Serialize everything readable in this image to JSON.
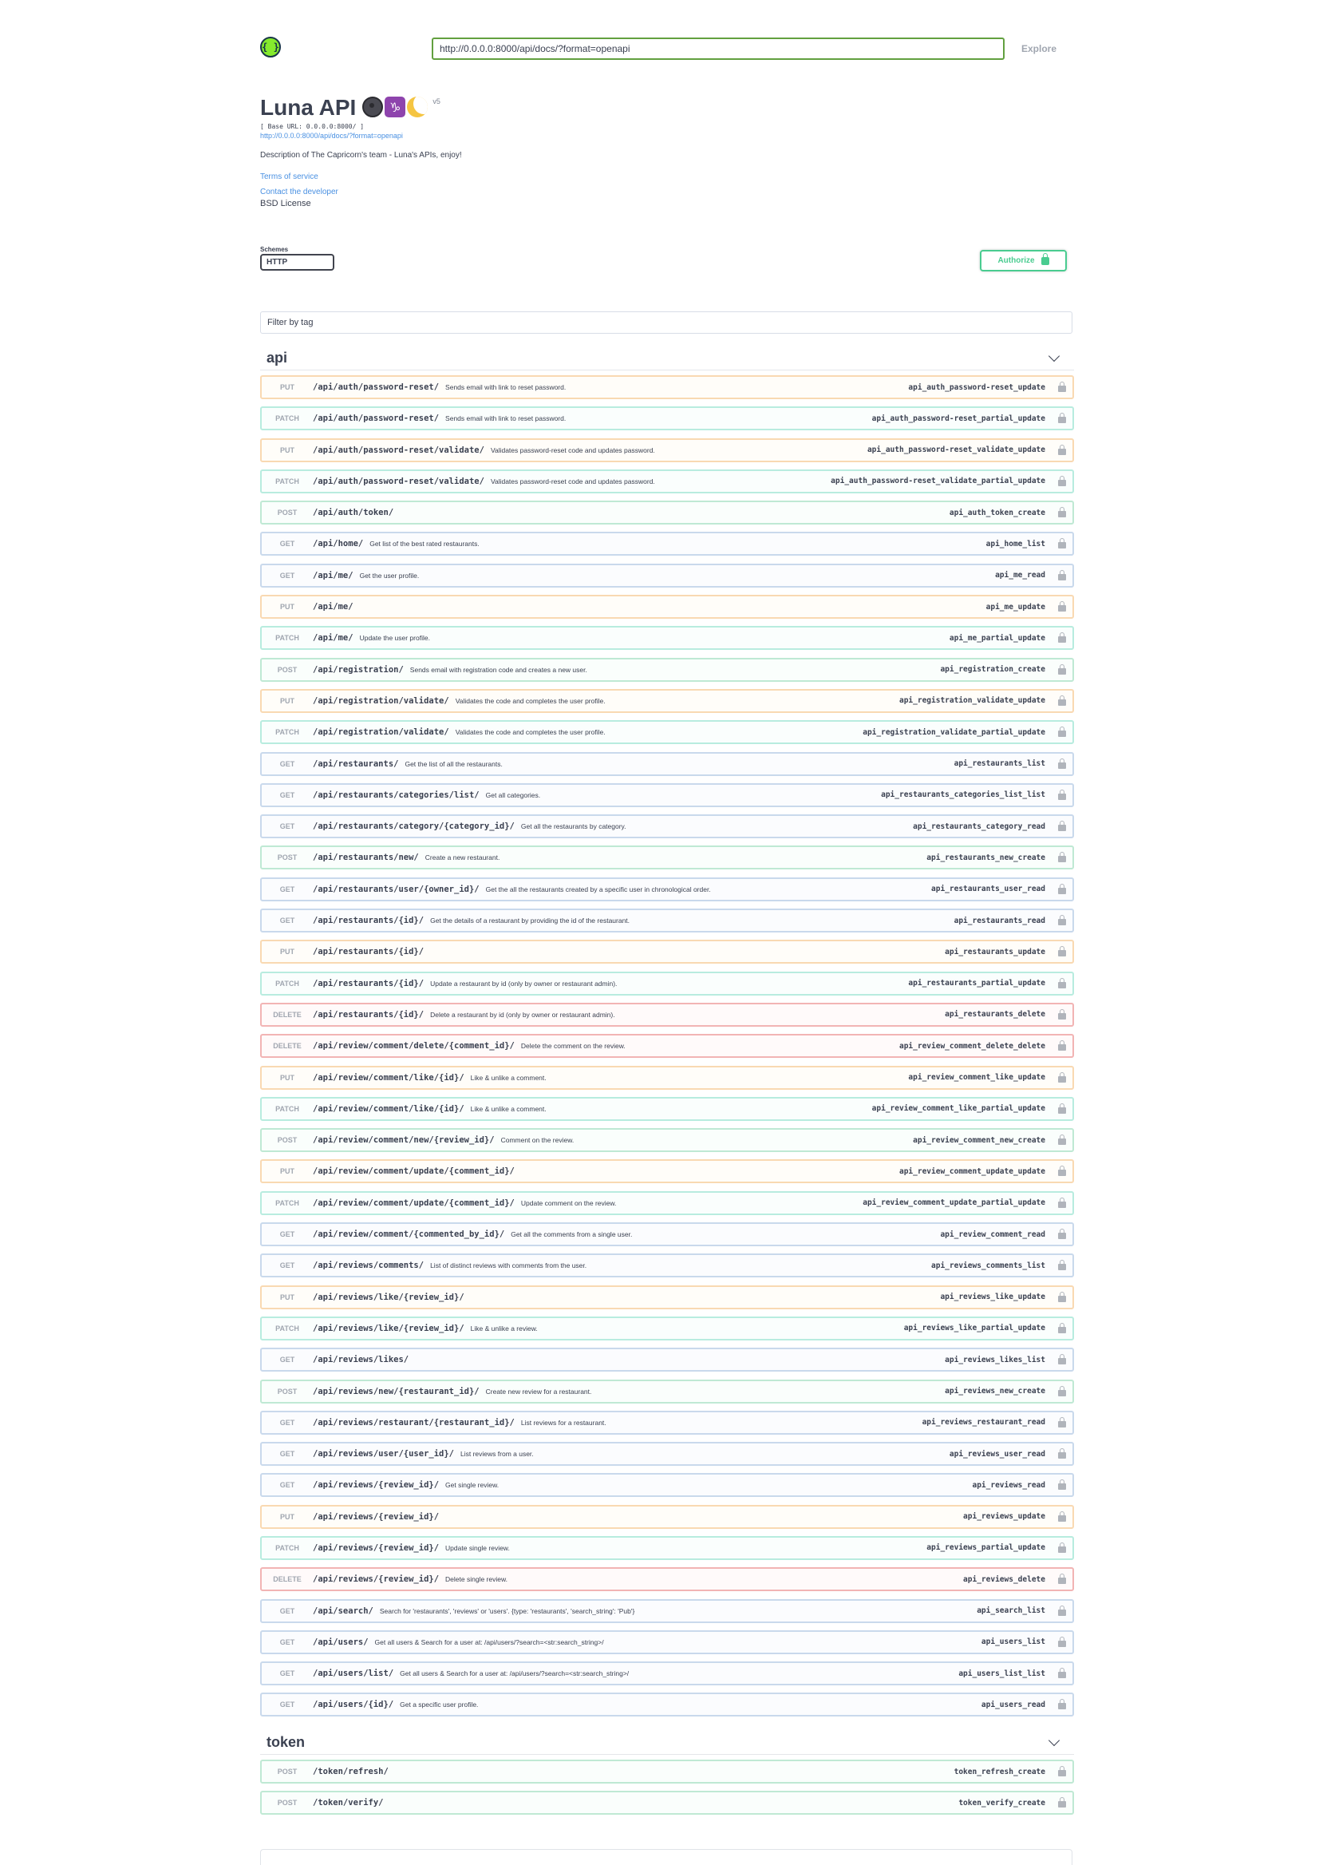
{
  "topbar": {
    "logo_glyph": "{ }",
    "url_value": "http://0.0.0.0:8000/api/docs/?format=openapi",
    "explore_label": "Explore"
  },
  "info": {
    "title": "Luna API",
    "emoji_cap": "♑",
    "version": "v5",
    "base_url": "[ Base URL: 0.0.0.0:8000/ ]",
    "spec_url": "http://0.0.0.0:8000/api/docs/?format=openapi",
    "description": "Description of The Capricorn's team - Luna's APIs, enjoy!",
    "terms_label": "Terms of service",
    "contact_label": "Contact the developer",
    "license_label": "BSD License"
  },
  "schemes": {
    "label": "Schemes",
    "selected": "HTTP",
    "authorize_label": "Authorize"
  },
  "filter": {
    "placeholder": "Filter by tag"
  },
  "tags": [
    {
      "name": "api",
      "operations": [
        {
          "method": "PUT",
          "path": "/api/auth/password-reset/",
          "summary": "Sends email with link to reset password.",
          "operation_id": "api_auth_password-reset_update"
        },
        {
          "method": "PATCH",
          "path": "/api/auth/password-reset/",
          "summary": "Sends email with link to reset password.",
          "operation_id": "api_auth_password-reset_partial_update"
        },
        {
          "method": "PUT",
          "path": "/api/auth/password-reset/validate/",
          "summary": "Validates password-reset code and updates password.",
          "operation_id": "api_auth_password-reset_validate_update"
        },
        {
          "method": "PATCH",
          "path": "/api/auth/password-reset/validate/",
          "summary": "Validates password-reset code and updates password.",
          "operation_id": "api_auth_password-reset_validate_partial_update"
        },
        {
          "method": "POST",
          "path": "/api/auth/token/",
          "summary": "",
          "operation_id": "api_auth_token_create"
        },
        {
          "method": "GET",
          "path": "/api/home/",
          "summary": "Get list of the best rated restaurants.",
          "operation_id": "api_home_list"
        },
        {
          "method": "GET",
          "path": "/api/me/",
          "summary": "Get the user profile.",
          "operation_id": "api_me_read"
        },
        {
          "method": "PUT",
          "path": "/api/me/",
          "summary": "",
          "operation_id": "api_me_update"
        },
        {
          "method": "PATCH",
          "path": "/api/me/",
          "summary": "Update the user profile.",
          "operation_id": "api_me_partial_update"
        },
        {
          "method": "POST",
          "path": "/api/registration/",
          "summary": "Sends email with registration code and creates a new user.",
          "operation_id": "api_registration_create"
        },
        {
          "method": "PUT",
          "path": "/api/registration/validate/",
          "summary": "Validates the code and completes the user profile.",
          "operation_id": "api_registration_validate_update"
        },
        {
          "method": "PATCH",
          "path": "/api/registration/validate/",
          "summary": "Validates the code and completes the user profile.",
          "operation_id": "api_registration_validate_partial_update"
        },
        {
          "method": "GET",
          "path": "/api/restaurants/",
          "summary": "Get the list of all the restaurants.",
          "operation_id": "api_restaurants_list"
        },
        {
          "method": "GET",
          "path": "/api/restaurants/categories/list/",
          "summary": "Get all categories.",
          "operation_id": "api_restaurants_categories_list_list"
        },
        {
          "method": "GET",
          "path": "/api/restaurants/category/{category_id}/",
          "summary": "Get all the restaurants by category.",
          "operation_id": "api_restaurants_category_read"
        },
        {
          "method": "POST",
          "path": "/api/restaurants/new/",
          "summary": "Create a new restaurant.",
          "operation_id": "api_restaurants_new_create"
        },
        {
          "method": "GET",
          "path": "/api/restaurants/user/{owner_id}/",
          "summary": "Get the all the restaurants created by a specific user in chronological order.",
          "operation_id": "api_restaurants_user_read"
        },
        {
          "method": "GET",
          "path": "/api/restaurants/{id}/",
          "summary": "Get the details of a restaurant by providing the id of the restaurant.",
          "operation_id": "api_restaurants_read"
        },
        {
          "method": "PUT",
          "path": "/api/restaurants/{id}/",
          "summary": "",
          "operation_id": "api_restaurants_update"
        },
        {
          "method": "PATCH",
          "path": "/api/restaurants/{id}/",
          "summary": "Update a restaurant by id (only by owner or restaurant admin).",
          "operation_id": "api_restaurants_partial_update"
        },
        {
          "method": "DELETE",
          "path": "/api/restaurants/{id}/",
          "summary": "Delete a restaurant by id (only by owner or restaurant admin).",
          "operation_id": "api_restaurants_delete"
        },
        {
          "method": "DELETE",
          "path": "/api/review/comment/delete/{comment_id}/",
          "summary": "Delete the comment on the review.",
          "operation_id": "api_review_comment_delete_delete"
        },
        {
          "method": "PUT",
          "path": "/api/review/comment/like/{id}/",
          "summary": "Like & unlike a comment.",
          "operation_id": "api_review_comment_like_update"
        },
        {
          "method": "PATCH",
          "path": "/api/review/comment/like/{id}/",
          "summary": "Like & unlike a comment.",
          "operation_id": "api_review_comment_like_partial_update"
        },
        {
          "method": "POST",
          "path": "/api/review/comment/new/{review_id}/",
          "summary": "Comment on the review.",
          "operation_id": "api_review_comment_new_create"
        },
        {
          "method": "PUT",
          "path": "/api/review/comment/update/{comment_id}/",
          "summary": "",
          "operation_id": "api_review_comment_update_update"
        },
        {
          "method": "PATCH",
          "path": "/api/review/comment/update/{comment_id}/",
          "summary": "Update comment on the review.",
          "operation_id": "api_review_comment_update_partial_update"
        },
        {
          "method": "GET",
          "path": "/api/review/comment/{commented_by_id}/",
          "summary": "Get all the comments from a single user.",
          "operation_id": "api_review_comment_read"
        },
        {
          "method": "GET",
          "path": "/api/reviews/comments/",
          "summary": "List of distinct reviews with comments from the user.",
          "operation_id": "api_reviews_comments_list"
        },
        {
          "method": "PUT",
          "path": "/api/reviews/like/{review_id}/",
          "summary": "",
          "operation_id": "api_reviews_like_update"
        },
        {
          "method": "PATCH",
          "path": "/api/reviews/like/{review_id}/",
          "summary": "Like & unlike a review.",
          "operation_id": "api_reviews_like_partial_update"
        },
        {
          "method": "GET",
          "path": "/api/reviews/likes/",
          "summary": "",
          "operation_id": "api_reviews_likes_list"
        },
        {
          "method": "POST",
          "path": "/api/reviews/new/{restaurant_id}/",
          "summary": "Create new review for a restaurant.",
          "operation_id": "api_reviews_new_create"
        },
        {
          "method": "GET",
          "path": "/api/reviews/restaurant/{restaurant_id}/",
          "summary": "List reviews for a restaurant.",
          "operation_id": "api_reviews_restaurant_read"
        },
        {
          "method": "GET",
          "path": "/api/reviews/user/{user_id}/",
          "summary": "List reviews from a user.",
          "operation_id": "api_reviews_user_read"
        },
        {
          "method": "GET",
          "path": "/api/reviews/{review_id}/",
          "summary": "Get single review.",
          "operation_id": "api_reviews_read"
        },
        {
          "method": "PUT",
          "path": "/api/reviews/{review_id}/",
          "summary": "",
          "operation_id": "api_reviews_update"
        },
        {
          "method": "PATCH",
          "path": "/api/reviews/{review_id}/",
          "summary": "Update single review.",
          "operation_id": "api_reviews_partial_update"
        },
        {
          "method": "DELETE",
          "path": "/api/reviews/{review_id}/",
          "summary": "Delete single review.",
          "operation_id": "api_reviews_delete"
        },
        {
          "method": "GET",
          "path": "/api/search/",
          "summary": "Search for 'restaurants', 'reviews' or 'users'. {type: 'restaurants', 'search_string': 'Pub'}",
          "operation_id": "api_search_list"
        },
        {
          "method": "GET",
          "path": "/api/users/",
          "summary": "Get all users & Search for a user at: /api/users/?search=<str:search_string>/",
          "operation_id": "api_users_list"
        },
        {
          "method": "GET",
          "path": "/api/users/list/",
          "summary": "Get all users & Search for a user at: /api/users/?search=<str:search_string>/",
          "operation_id": "api_users_list_list"
        },
        {
          "method": "GET",
          "path": "/api/users/{id}/",
          "summary": "Get a specific user profile.",
          "operation_id": "api_users_read"
        }
      ]
    },
    {
      "name": "token",
      "operations": [
        {
          "method": "POST",
          "path": "/token/refresh/",
          "summary": "",
          "operation_id": "token_refresh_create"
        },
        {
          "method": "POST",
          "path": "/token/verify/",
          "summary": "",
          "operation_id": "token_verify_create"
        }
      ]
    }
  ],
  "icons": {
    "logo": "swagger-logo-icon",
    "lock": "lock-icon",
    "chevron": "chevron-down-icon"
  },
  "colors": {
    "get": "#61affe",
    "post": "#49cc90",
    "put": "#fca130",
    "patch": "#50e3c2",
    "delete": "#f93e3e",
    "accent": "#62a03f"
  }
}
